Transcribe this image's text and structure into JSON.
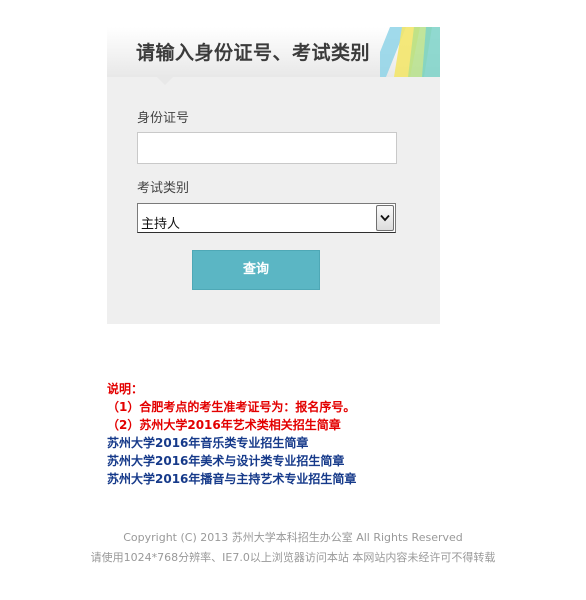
{
  "form": {
    "title": "请输入身份证号、考试类别",
    "id_label": "身份证号",
    "id_value": "",
    "id_placeholder": "",
    "exam_label": "考试类别",
    "exam_selected": "主持人",
    "submit_label": "查询"
  },
  "notes": {
    "heading": "说明：",
    "line1": "（1）合肥考点的考生准考证号为：报名序号。",
    "line2": "（2）苏州大学2016年艺术类相关招生简章",
    "links": [
      "苏州大学2016年音乐类专业招生简章",
      "苏州大学2016年美术与设计类专业招生简章",
      "苏州大学2016年播音与主持艺术专业招生简章"
    ]
  },
  "footer": {
    "copyright": "Copyright (C) 2013 苏州大学本科招生办公室 All Rights Reserved",
    "notice": "请使用1024*768分辨率、IE7.0以上浏览器访问本站 本网站内容未经许可不得转载"
  },
  "colors": {
    "panel_bg": "#efefef",
    "button": "#5bb6c4",
    "note_red": "#e30000",
    "link_blue": "#163a8a",
    "footer_gray": "#999999"
  },
  "icons": {
    "select_arrow": "chevron-down-icon"
  }
}
